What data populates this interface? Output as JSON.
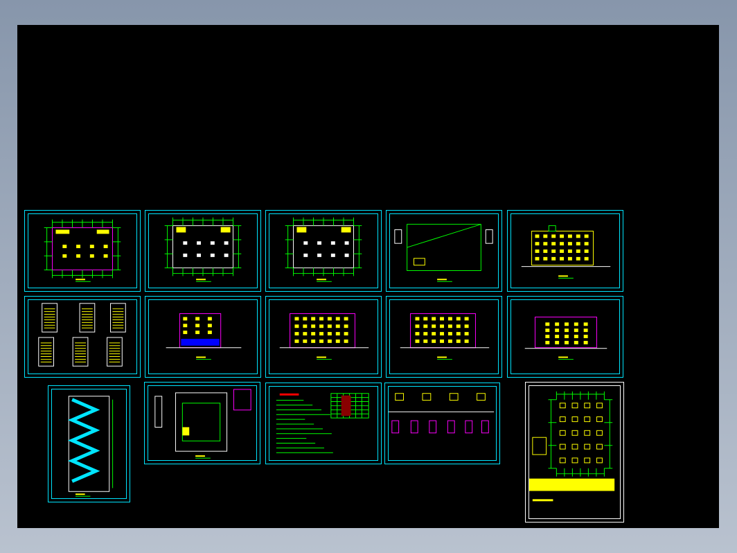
{
  "app": {
    "background": "#000000",
    "frame_color": "#00e5ff"
  },
  "colors": {
    "wall": "#ffffff",
    "dimension": "#00ff00",
    "window": "#ffff00",
    "outline": "#ff00ff",
    "stair": "#00e5ff",
    "table_text": "#ff0000",
    "base": "#0000ff"
  },
  "sheets": [
    {
      "kind": "plan-first"
    },
    {
      "kind": "plan"
    },
    {
      "kind": "plan"
    },
    {
      "kind": "plan-roof"
    },
    {
      "kind": "elevation-side"
    },
    {
      "kind": "stair-details"
    },
    {
      "kind": "elevation-base"
    },
    {
      "kind": "elevation-front"
    },
    {
      "kind": "elevation-front"
    },
    {
      "kind": "elevation-back"
    },
    {
      "kind": "stair-section"
    },
    {
      "kind": "site-plan"
    },
    {
      "kind": "notes"
    },
    {
      "kind": "door-window"
    },
    {
      "kind": "structure"
    }
  ]
}
